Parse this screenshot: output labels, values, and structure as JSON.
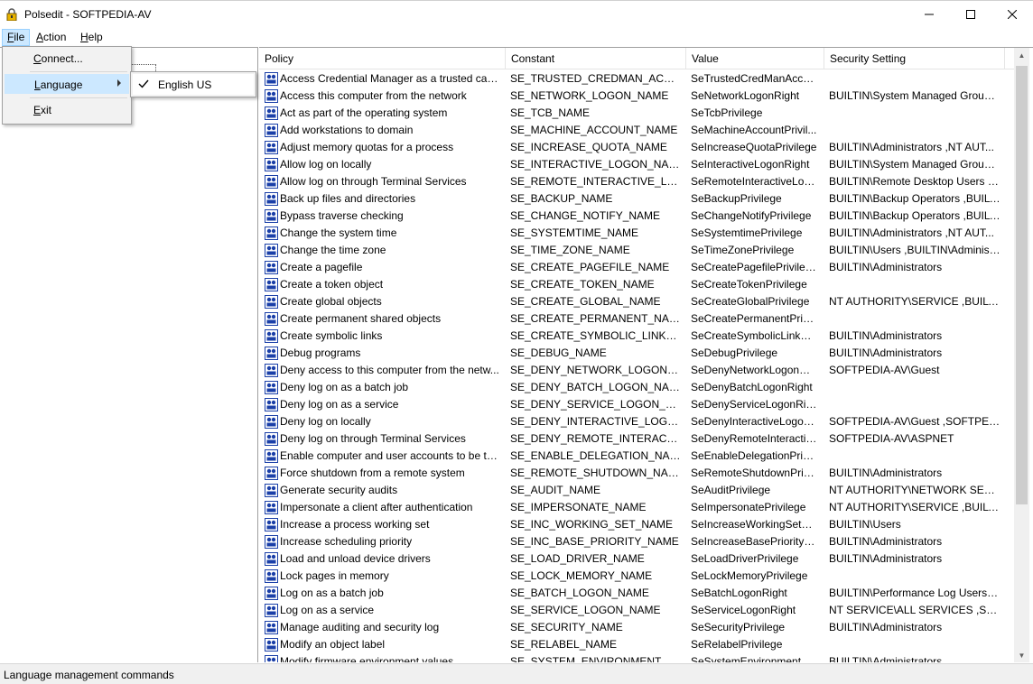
{
  "window": {
    "title": "Polsedit - SOFTPEDIA-AV",
    "minimize_icon": "minimize-icon",
    "maximize_icon": "maximize-icon",
    "close_icon": "close-icon"
  },
  "menubar": {
    "file": {
      "label": "File",
      "accel": "F",
      "rest": "ile"
    },
    "action": {
      "label": "Action",
      "accel": "A",
      "rest": "ction"
    },
    "help": {
      "label": "Help",
      "accel": "H",
      "rest": "elp"
    }
  },
  "file_menu": {
    "connect": {
      "accel": "C",
      "rest": "onnect..."
    },
    "language": {
      "accel": "L",
      "rest": "anguage"
    },
    "exit": {
      "accel": "E",
      "rest": "xit"
    }
  },
  "language_submenu": {
    "english": "English US"
  },
  "table": {
    "columns": [
      "Policy",
      "Constant",
      "Value",
      "Security Setting"
    ],
    "rows": [
      [
        "Access Credential Manager as a trusted caller",
        "SE_TRUSTED_CREDMAN_ACCESS...",
        "SeTrustedCredManAcces...",
        ""
      ],
      [
        "Access this computer from the network",
        "SE_NETWORK_LOGON_NAME",
        "SeNetworkLogonRight",
        "BUILTIN\\System Managed Group ..."
      ],
      [
        "Act as part of the operating system",
        "SE_TCB_NAME",
        "SeTcbPrivilege",
        ""
      ],
      [
        "Add workstations to domain",
        "SE_MACHINE_ACCOUNT_NAME",
        "SeMachineAccountPrivil...",
        ""
      ],
      [
        "Adjust memory quotas for a process",
        "SE_INCREASE_QUOTA_NAME",
        "SeIncreaseQuotaPrivilege",
        "BUILTIN\\Administrators ,NT AUT..."
      ],
      [
        "Allow log on locally",
        "SE_INTERACTIVE_LOGON_NAME",
        "SeInteractiveLogonRight",
        "BUILTIN\\System Managed Group ..."
      ],
      [
        "Allow log on through Terminal Services",
        "SE_REMOTE_INTERACTIVE_LOGO...",
        "SeRemoteInteractiveLog...",
        "BUILTIN\\Remote Desktop Users ,B..."
      ],
      [
        "Back up files and directories",
        "SE_BACKUP_NAME",
        "SeBackupPrivilege",
        "BUILTIN\\Backup Operators ,BUILT..."
      ],
      [
        "Bypass traverse checking",
        "SE_CHANGE_NOTIFY_NAME",
        "SeChangeNotifyPrivilege",
        "BUILTIN\\Backup Operators ,BUILT..."
      ],
      [
        "Change the system time",
        "SE_SYSTEMTIME_NAME",
        "SeSystemtimePrivilege",
        "BUILTIN\\Administrators ,NT AUT..."
      ],
      [
        "Change the time zone",
        "SE_TIME_ZONE_NAME",
        "SeTimeZonePrivilege",
        "BUILTIN\\Users ,BUILTIN\\Administ..."
      ],
      [
        "Create a pagefile",
        "SE_CREATE_PAGEFILE_NAME",
        "SeCreatePagefilePrivilege",
        "BUILTIN\\Administrators"
      ],
      [
        "Create a token object",
        "SE_CREATE_TOKEN_NAME",
        "SeCreateTokenPrivilege",
        ""
      ],
      [
        "Create global objects",
        "SE_CREATE_GLOBAL_NAME",
        "SeCreateGlobalPrivilege",
        "NT AUTHORITY\\SERVICE ,BUILTI..."
      ],
      [
        "Create permanent shared objects",
        "SE_CREATE_PERMANENT_NAME",
        "SeCreatePermanentPrivil...",
        ""
      ],
      [
        "Create symbolic links",
        "SE_CREATE_SYMBOLIC_LINK_NA...",
        "SeCreateSymbolicLinkPri...",
        "BUILTIN\\Administrators"
      ],
      [
        "Debug programs",
        "SE_DEBUG_NAME",
        "SeDebugPrivilege",
        "BUILTIN\\Administrators"
      ],
      [
        "Deny access to this computer from the netw...",
        "SE_DENY_NETWORK_LOGON_NA...",
        "SeDenyNetworkLogonRi...",
        "SOFTPEDIA-AV\\Guest"
      ],
      [
        "Deny log on as a batch job",
        "SE_DENY_BATCH_LOGON_NAME",
        "SeDenyBatchLogonRight",
        ""
      ],
      [
        "Deny log on as a service",
        "SE_DENY_SERVICE_LOGON_NAME",
        "SeDenyServiceLogonRight",
        ""
      ],
      [
        "Deny log on locally",
        "SE_DENY_INTERACTIVE_LOGON_...",
        "SeDenyInteractiveLogon...",
        "SOFTPEDIA-AV\\Guest ,SOFTPEDI..."
      ],
      [
        "Deny log on through Terminal Services",
        "SE_DENY_REMOTE_INTERACTIVE_...",
        "SeDenyRemoteInteractiv...",
        "SOFTPEDIA-AV\\ASPNET"
      ],
      [
        "Enable computer and user accounts to be tru...",
        "SE_ENABLE_DELEGATION_NAME",
        "SeEnableDelegationPrivil...",
        ""
      ],
      [
        "Force shutdown from a remote system",
        "SE_REMOTE_SHUTDOWN_NAME",
        "SeRemoteShutdownPrivi...",
        "BUILTIN\\Administrators"
      ],
      [
        "Generate security audits",
        "SE_AUDIT_NAME",
        "SeAuditPrivilege",
        "NT AUTHORITY\\NETWORK SERVI..."
      ],
      [
        "Impersonate a client after authentication",
        "SE_IMPERSONATE_NAME",
        "SeImpersonatePrivilege",
        "NT AUTHORITY\\SERVICE ,BUILTI..."
      ],
      [
        "Increase a process working set",
        "SE_INC_WORKING_SET_NAME",
        "SeIncreaseWorkingSetPri...",
        "BUILTIN\\Users"
      ],
      [
        "Increase scheduling priority",
        "SE_INC_BASE_PRIORITY_NAME",
        "SeIncreaseBasePriorityPri...",
        "BUILTIN\\Administrators"
      ],
      [
        "Load and unload device drivers",
        "SE_LOAD_DRIVER_NAME",
        "SeLoadDriverPrivilege",
        "BUILTIN\\Administrators"
      ],
      [
        "Lock pages in memory",
        "SE_LOCK_MEMORY_NAME",
        "SeLockMemoryPrivilege",
        ""
      ],
      [
        "Log on as a batch job",
        "SE_BATCH_LOGON_NAME",
        "SeBatchLogonRight",
        "BUILTIN\\Performance Log Users ,..."
      ],
      [
        "Log on as a service",
        "SE_SERVICE_LOGON_NAME",
        "SeServiceLogonRight",
        "NT SERVICE\\ALL SERVICES ,SOFT..."
      ],
      [
        "Manage auditing and security log",
        "SE_SECURITY_NAME",
        "SeSecurityPrivilege",
        "BUILTIN\\Administrators"
      ],
      [
        "Modify an object label",
        "SE_RELABEL_NAME",
        "SeRelabelPrivilege",
        ""
      ],
      [
        "Modify firmware environment values",
        "SE_SYSTEM_ENVIRONMENT_NAME",
        "SeSystemEnvironmentPri...",
        "BUILTIN\\Administrators"
      ]
    ]
  },
  "statusbar": {
    "text": "Language management commands"
  },
  "colors": {
    "menu_highlight": "#cce8ff",
    "menu_bg": "#f2f2f2",
    "icon_blue": "#1a3fa8"
  }
}
